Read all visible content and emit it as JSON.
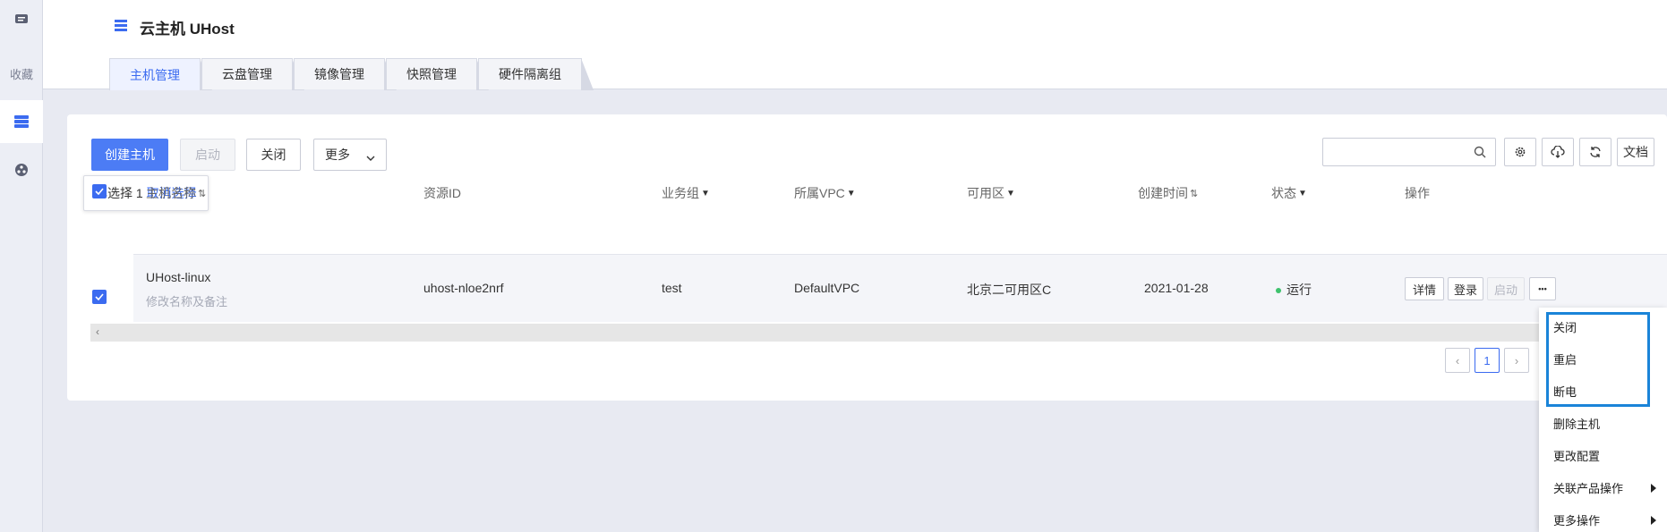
{
  "rail": {
    "fav_label": "收藏"
  },
  "header": {
    "title": "云主机 UHost",
    "tabs": [
      "主机管理",
      "云盘管理",
      "镜像管理",
      "快照管理",
      "硬件隔离组"
    ],
    "active_tab": "主机管理"
  },
  "toolbar": {
    "create": "创建主机",
    "start": "启动",
    "stop": "关闭",
    "more": "更多",
    "search_placeholder": "",
    "docs": "文档"
  },
  "selection": {
    "text": "已选择 1",
    "cancel": "取消选择"
  },
  "table": {
    "columns": [
      "主机名称",
      "资源ID",
      "业务组",
      "所属VPC",
      "可用区",
      "创建时间",
      "状态",
      "操作"
    ],
    "row": {
      "name": "UHost-linux",
      "remark": "修改名称及备注",
      "resource_id": "uhost-nloe2nrf",
      "group": "test",
      "vpc": "DefaultVPC",
      "zone": "北京二可用区C",
      "created": "2021-01-28",
      "status": "运行",
      "actions": {
        "detail": "详情",
        "login": "登录",
        "start": "启动",
        "more": "•••"
      }
    }
  },
  "pagination": {
    "prev": "‹",
    "current": "1",
    "next": "›"
  },
  "menu": {
    "items": [
      "关闭",
      "重启",
      "断电",
      "删除主机",
      "更改配置",
      "关联产品操作",
      "更多操作"
    ]
  },
  "colors": {
    "accent": "#3b6bf0",
    "primary_button": "#4c7cf5",
    "status_running": "#3ec26d",
    "highlight_border": "#1a84d8"
  }
}
